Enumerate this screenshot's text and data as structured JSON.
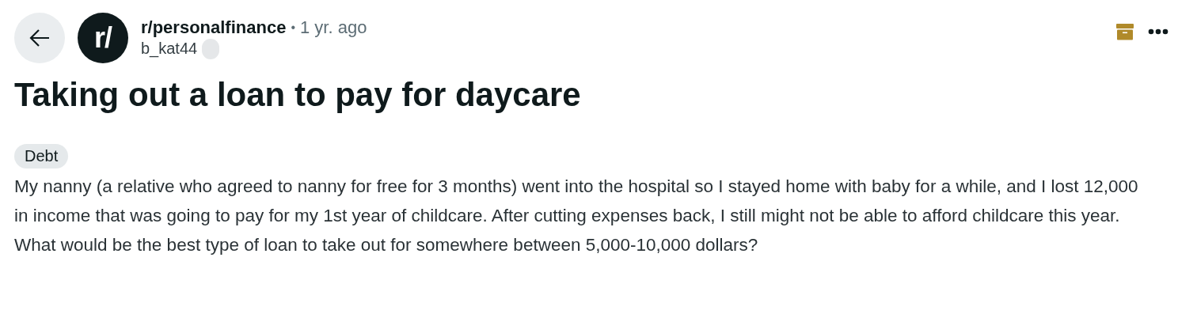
{
  "post": {
    "community_avatar": "r/",
    "community": "r/personalfinance",
    "separator": "•",
    "time": "1 yr. ago",
    "author": "b_kat44",
    "title": "Taking out a loan to pay for daycare",
    "flair": "Debt",
    "body": "My nanny (a relative who agreed to nanny for free for 3 months) went into the hospital so I stayed home with baby for a while, and I lost 12,000 in income that was going to pay for my 1st year of childcare. After cutting expenses back, I still might not be able to afford childcare this year. What would be the best type of loan to take out for somewhere between 5,000-10,000 dollars?"
  }
}
